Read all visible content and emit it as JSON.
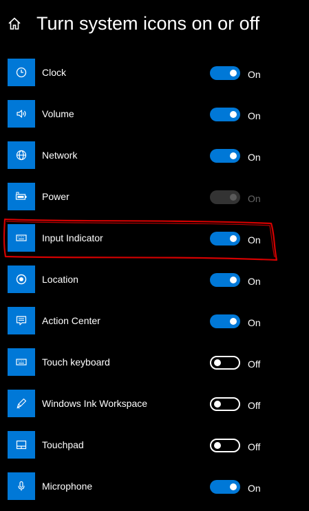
{
  "header": {
    "home_icon": "home-icon",
    "title": "Turn system icons on or off"
  },
  "colors": {
    "background": "#000000",
    "accent": "#0078d7",
    "text": "#ffffff",
    "disabled_text": "#666666",
    "disabled_track": "#333333",
    "annotation": "#d40000"
  },
  "items": [
    {
      "label": "Clock",
      "icon": "clock-icon",
      "on": true,
      "enabled": true,
      "state": "On"
    },
    {
      "label": "Volume",
      "icon": "volume-icon",
      "on": true,
      "enabled": true,
      "state": "On"
    },
    {
      "label": "Network",
      "icon": "network-globe-icon",
      "on": true,
      "enabled": true,
      "state": "On"
    },
    {
      "label": "Power",
      "icon": "battery-icon",
      "on": true,
      "enabled": false,
      "state": "On"
    },
    {
      "label": "Input Indicator",
      "icon": "keyboard-icon",
      "on": true,
      "enabled": true,
      "state": "On"
    },
    {
      "label": "Location",
      "icon": "location-icon",
      "on": true,
      "enabled": true,
      "state": "On"
    },
    {
      "label": "Action Center",
      "icon": "action-center-icon",
      "on": true,
      "enabled": true,
      "state": "On"
    },
    {
      "label": "Touch keyboard",
      "icon": "touch-keyboard-icon",
      "on": false,
      "enabled": true,
      "state": "Off"
    },
    {
      "label": "Windows Ink Workspace",
      "icon": "pen-icon",
      "on": false,
      "enabled": true,
      "state": "Off"
    },
    {
      "label": "Touchpad",
      "icon": "touchpad-icon",
      "on": false,
      "enabled": true,
      "state": "Off"
    },
    {
      "label": "Microphone",
      "icon": "microphone-icon",
      "on": true,
      "enabled": true,
      "state": "On"
    }
  ],
  "annotation": {
    "type": "red-freehand-outline",
    "highlighted_item": "Input Indicator"
  }
}
